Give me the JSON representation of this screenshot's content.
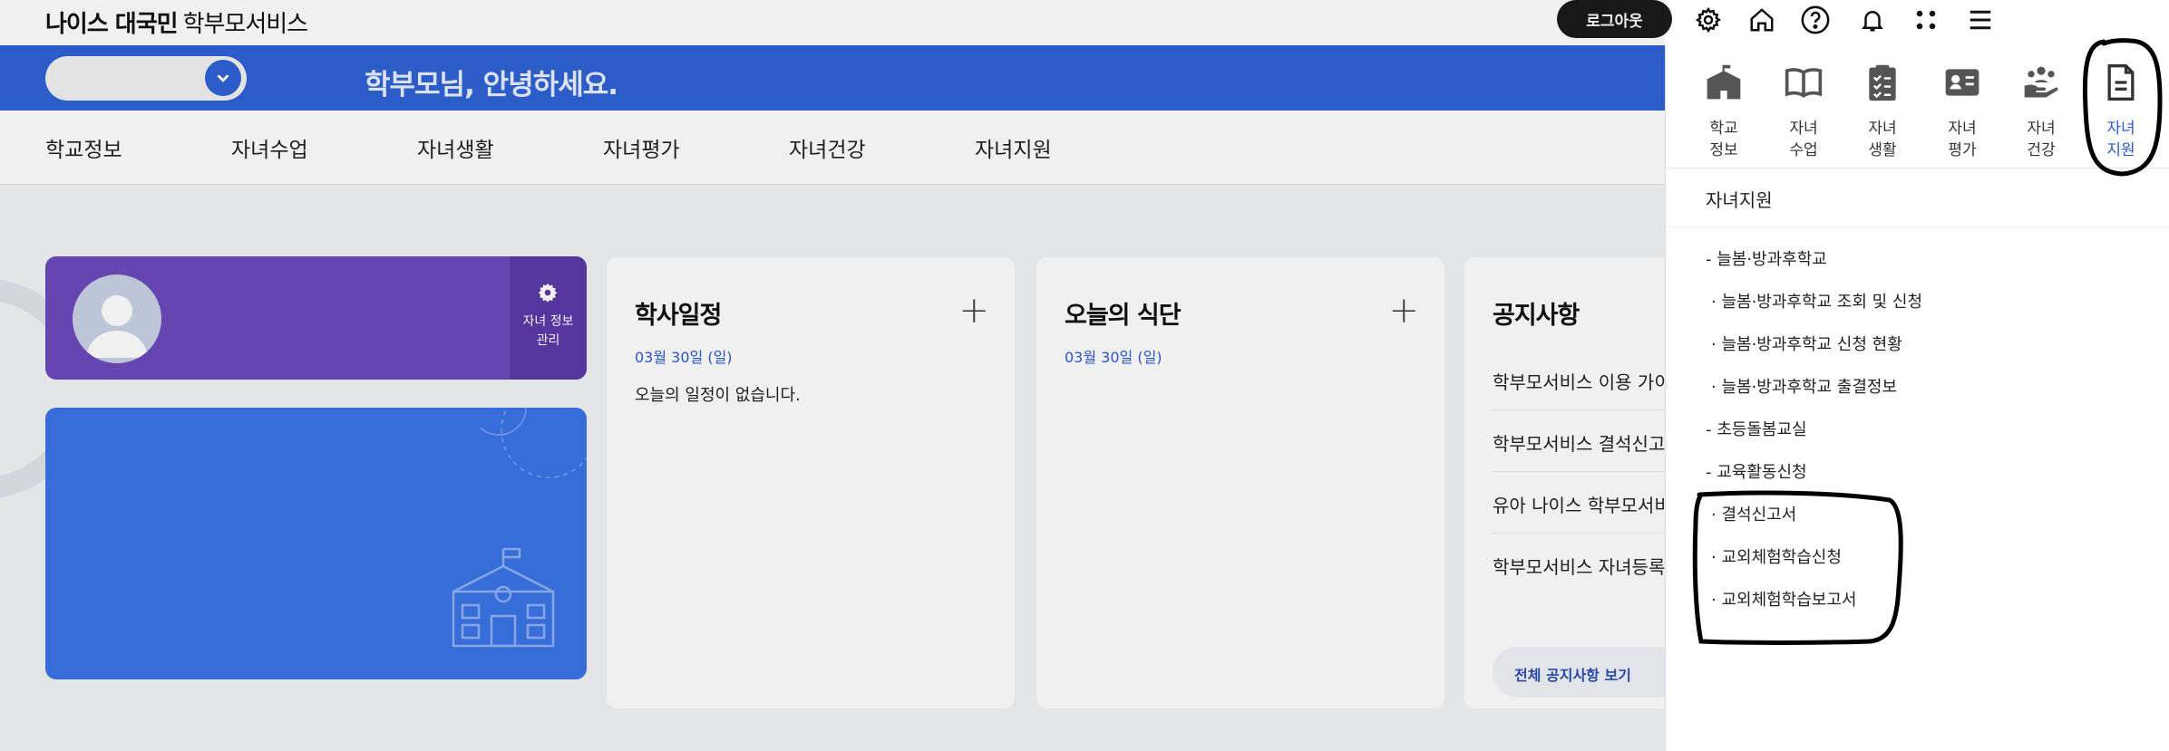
{
  "header": {
    "logo_brand": "나이스 대국민",
    "logo_service": "학부모서비스",
    "logout_label": "로그아웃",
    "icons": [
      "gear-icon",
      "home-icon",
      "help-icon",
      "bell-icon",
      "apps-grid-icon",
      "menu-icon"
    ]
  },
  "hero": {
    "greeting": "학부모님, 안녕하세요."
  },
  "nav": {
    "items": [
      "학교정보",
      "자녀수업",
      "자녀생활",
      "자녀평가",
      "자녀건강",
      "자녀지원"
    ]
  },
  "profile": {
    "manage_label_1": "자녀 정보",
    "manage_label_2": "관리"
  },
  "schedule": {
    "title": "학사일정",
    "date": "03월 30일 (일)",
    "empty": "오늘의 일정이 없습니다."
  },
  "meal": {
    "title": "오늘의 식단",
    "date": "03월 30일 (일)"
  },
  "notice": {
    "title": "공지사항",
    "items": [
      "학부모서비스 이용 가이",
      "학부모서비스 결석신고",
      "유아 나이스 학부모서비",
      "학부모서비스 자녀등록"
    ],
    "view_all": "전체 공지사항 보기"
  },
  "panel": {
    "tabs": [
      {
        "l1": "학교",
        "l2": "정보",
        "icon": "school-icon"
      },
      {
        "l1": "자녀",
        "l2": "수업",
        "icon": "book-icon"
      },
      {
        "l1": "자녀",
        "l2": "생활",
        "icon": "clipboard-icon"
      },
      {
        "l1": "자녀",
        "l2": "평가",
        "icon": "id-card-icon"
      },
      {
        "l1": "자녀",
        "l2": "건강",
        "icon": "hands-care-icon"
      },
      {
        "l1": "자녀",
        "l2": "지원",
        "icon": "document-icon"
      }
    ],
    "heading": "자녀지원",
    "menu": [
      "- 늘봄·방과후학교",
      "· 늘봄·방과후학교 조회 및 신청",
      "· 늘봄·방과후학교 신청 현황",
      "· 늘봄·방과후학교 출결정보",
      "- 초등돌봄교실",
      "- 교육활동신청",
      "· 결석신고서",
      "· 교외체험학습신청",
      "· 교외체험학습보고서"
    ]
  },
  "colors": {
    "brand_blue": "#2f62d4",
    "profile_purple": "#6c4bbb",
    "active_tab": "#2b5bd0"
  }
}
